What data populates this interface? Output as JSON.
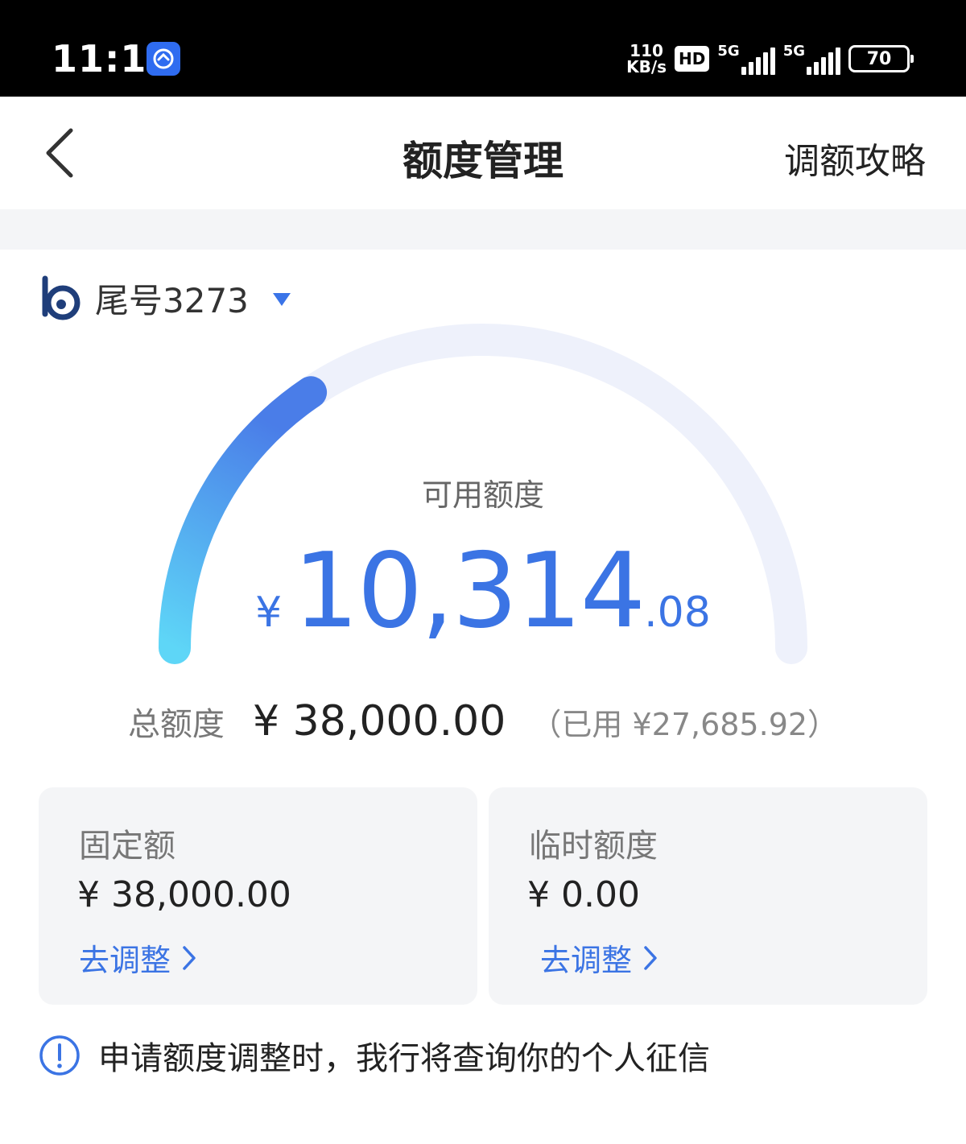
{
  "status_bar": {
    "time": "11:16",
    "speed_value": "110",
    "speed_unit": "KB/s",
    "hd_label": "HD",
    "net1_label": "5G",
    "net2_label": "5G",
    "battery": "70",
    "icons": [
      "app-icon",
      "signal-icon",
      "battery-icon"
    ]
  },
  "nav": {
    "title": "额度管理",
    "right_action": "调额攻略",
    "back_icon": "chevron-left-icon"
  },
  "card": {
    "label": "尾号3273",
    "logo_icon": "bank-logo-icon",
    "caret_icon": "caret-down-icon"
  },
  "gauge": {
    "available_label": "可用额度",
    "currency": "¥",
    "available_int": "10,314",
    "available_dec": ".08",
    "used_fraction": 0.7286,
    "colors": {
      "track": "#eef1fb",
      "start": "#5ed6f7",
      "end": "#4a7de8"
    }
  },
  "total": {
    "label": "总额度",
    "value": "¥ 38,000.00",
    "used_note": "（已用 ¥27,685.92）"
  },
  "quotas": {
    "fixed": {
      "title": "固定额",
      "value": "¥ 38,000.00",
      "link": "去调整"
    },
    "temp": {
      "title": "临时额度",
      "value": "¥ 0.00",
      "link": "去调整"
    }
  },
  "notice": {
    "text": "申请额度调整时，我行将查询你的个人征信",
    "icon": "info-icon"
  },
  "accent_color": "#3b74e4"
}
